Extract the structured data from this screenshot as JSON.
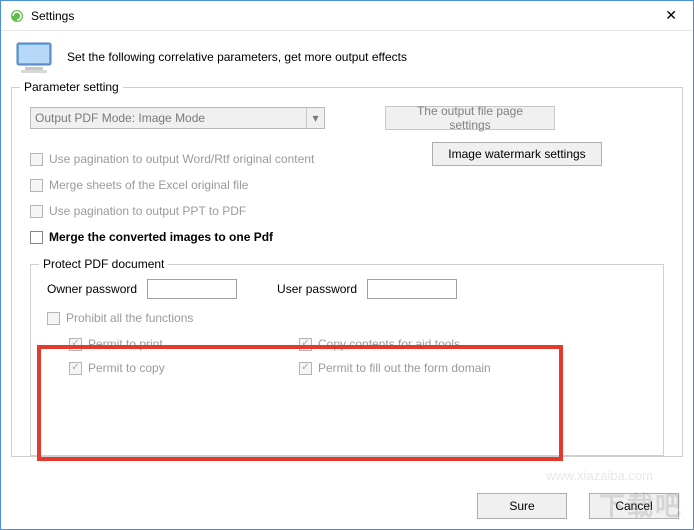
{
  "window": {
    "title": "Settings"
  },
  "header": {
    "text": "Set the following correlative parameters, get more output effects"
  },
  "fieldset": {
    "legend": "Parameter setting",
    "dropdown_label": "Output PDF Mode: Image Mode",
    "btn_page_settings": "The output file page settings",
    "btn_watermark": "Image watermark settings",
    "cb_pagination_word": "Use pagination to output Word/Rtf original content",
    "cb_merge_excel": "Merge sheets of the Excel original file",
    "cb_pagination_ppt": "Use pagination to output PPT to PDF",
    "cb_merge_images": "Merge the converted images to one Pdf"
  },
  "protect": {
    "legend": "Protect PDF document",
    "owner_label": "Owner password",
    "owner_value": "",
    "user_label": "User password",
    "user_value": "",
    "cb_prohibit": "Prohibit all the functions",
    "cb_print": "Permit to print",
    "cb_copy": "Permit to copy",
    "cb_copy_aid": "Copy contents for aid tools",
    "cb_fill_form": "Permit to fill out the form domain"
  },
  "footer": {
    "sure": "Sure",
    "cancel": "Cancel"
  },
  "watermark": {
    "text": "下载吧",
    "url": "www.xiazaiba.com"
  }
}
